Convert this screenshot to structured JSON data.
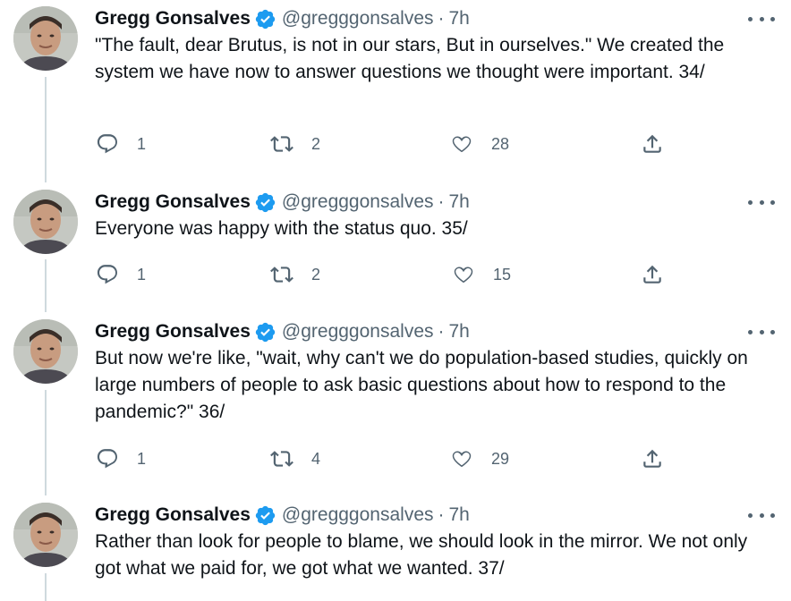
{
  "tweets": [
    {
      "name": "Gregg Gonsalves",
      "handle": "@gregggonsalves",
      "dot": "·",
      "time": "7h",
      "text": "\"The fault, dear Brutus, is not in our stars, But in ourselves.\" We created the system we have now to answer questions we thought were important. 34/",
      "replies": "1",
      "retweets": "2",
      "likes": "28"
    },
    {
      "name": "Gregg Gonsalves",
      "handle": "@gregggonsalves",
      "dot": "·",
      "time": "7h",
      "text": "Everyone was happy with the status quo. 35/",
      "replies": "1",
      "retweets": "2",
      "likes": "15"
    },
    {
      "name": "Gregg Gonsalves",
      "handle": "@gregggonsalves",
      "dot": "·",
      "time": "7h",
      "text": "But now we're like, \"wait, why can't we do population-based studies, quickly on large numbers of people to ask basic questions about how to respond to the pandemic?\" 36/",
      "replies": "1",
      "retweets": "4",
      "likes": "29"
    },
    {
      "name": "Gregg Gonsalves",
      "handle": "@gregggonsalves",
      "dot": "·",
      "time": "7h",
      "text": "Rather than look for people to blame, we should look in the mirror. We not only got what we paid for, we got what we wanted. 37/"
    }
  ],
  "colors": {
    "text": "#0f1419",
    "secondary": "#536471",
    "verified": "#1d9bf0",
    "thread_line": "#cfd9de"
  },
  "icons": [
    "verified-badge-icon",
    "more-icon",
    "reply-icon",
    "retweet-icon",
    "like-icon",
    "share-icon"
  ]
}
